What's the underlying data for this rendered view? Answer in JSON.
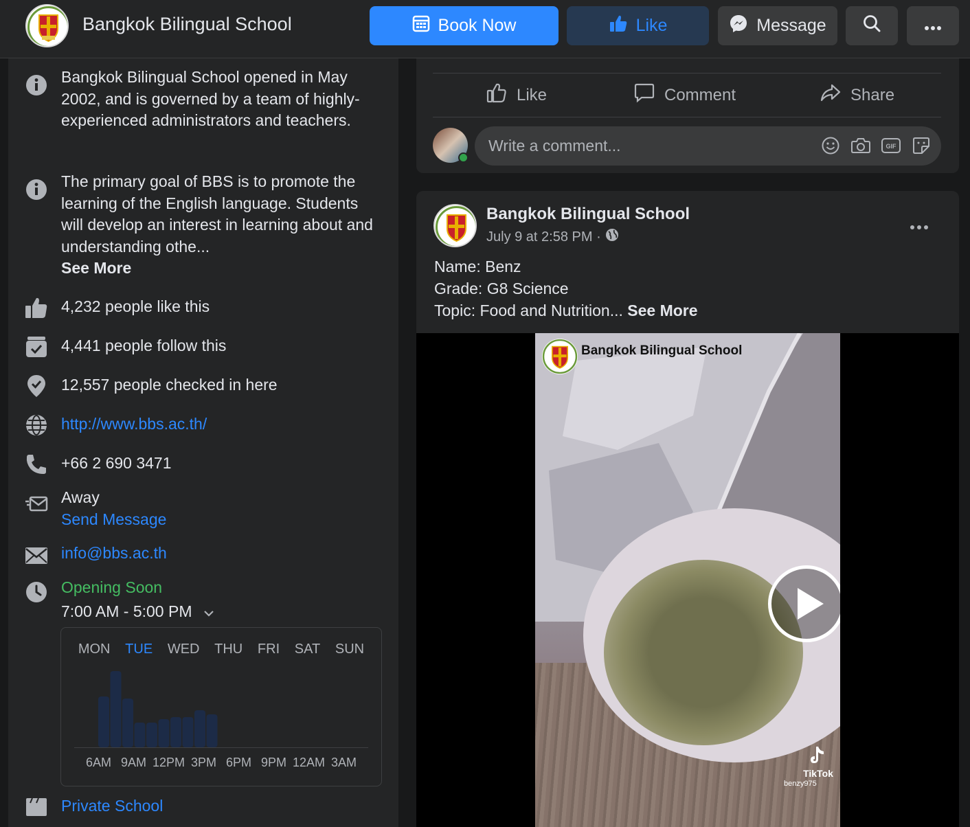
{
  "header": {
    "page_name": "Bangkok Bilingual School",
    "book_label": "Book Now",
    "like_label": "Like",
    "message_label": "Message"
  },
  "about": {
    "description1": "Bangkok Bilingual School opened in May 2002, and is governed by a team of highly-experienced administrators and teachers.",
    "description2": "The primary goal of BBS is to promote the learning of the English language. Students will develop an interest in learning about and understanding othe...",
    "see_more": "See More",
    "likes": "4,232 people like this",
    "follows": "4,441 people follow this",
    "checkins": "12,557 people checked in here",
    "website": "http://www.bbs.ac.th/",
    "phone": "+66 2 690 3471",
    "away": "Away",
    "send_message": "Send Message",
    "email": "info@bbs.ac.th",
    "opening_status": "Opening Soon",
    "hours": "7:00 AM - 5:00 PM",
    "category": "Private School"
  },
  "popular_times": {
    "days": [
      "MON",
      "TUE",
      "WED",
      "THU",
      "FRI",
      "SAT",
      "SUN"
    ],
    "active_day": "TUE",
    "time_labels": [
      "6AM",
      "9AM",
      "12PM",
      "3PM",
      "6PM",
      "9PM",
      "12AM",
      "3AM"
    ],
    "levels": [
      0.49,
      0.74,
      0.47,
      0.24,
      0.24,
      0.27,
      0.29,
      0.29,
      0.36,
      0.32
    ],
    "bar_color": "#1c2b47"
  },
  "post1_actions": {
    "like": "Like",
    "comment": "Comment",
    "share": "Share",
    "comment_placeholder": "Write a comment..."
  },
  "post2": {
    "author": "Bangkok Bilingual School",
    "date": "July 9 at 2:58 PM ·",
    "line1": "Name: Benz",
    "line2": "Grade: G8 Science",
    "line3": "Topic: Food and Nutrition...",
    "see_more": "See More",
    "watermark": "Bangkok Bilingual School",
    "tiktok_label": "TikTok",
    "tiktok_user": "benzy975"
  },
  "colors": {
    "accent": "#2d88ff",
    "open_green": "#45bd62",
    "card": "#242526",
    "background": "#18191a"
  }
}
